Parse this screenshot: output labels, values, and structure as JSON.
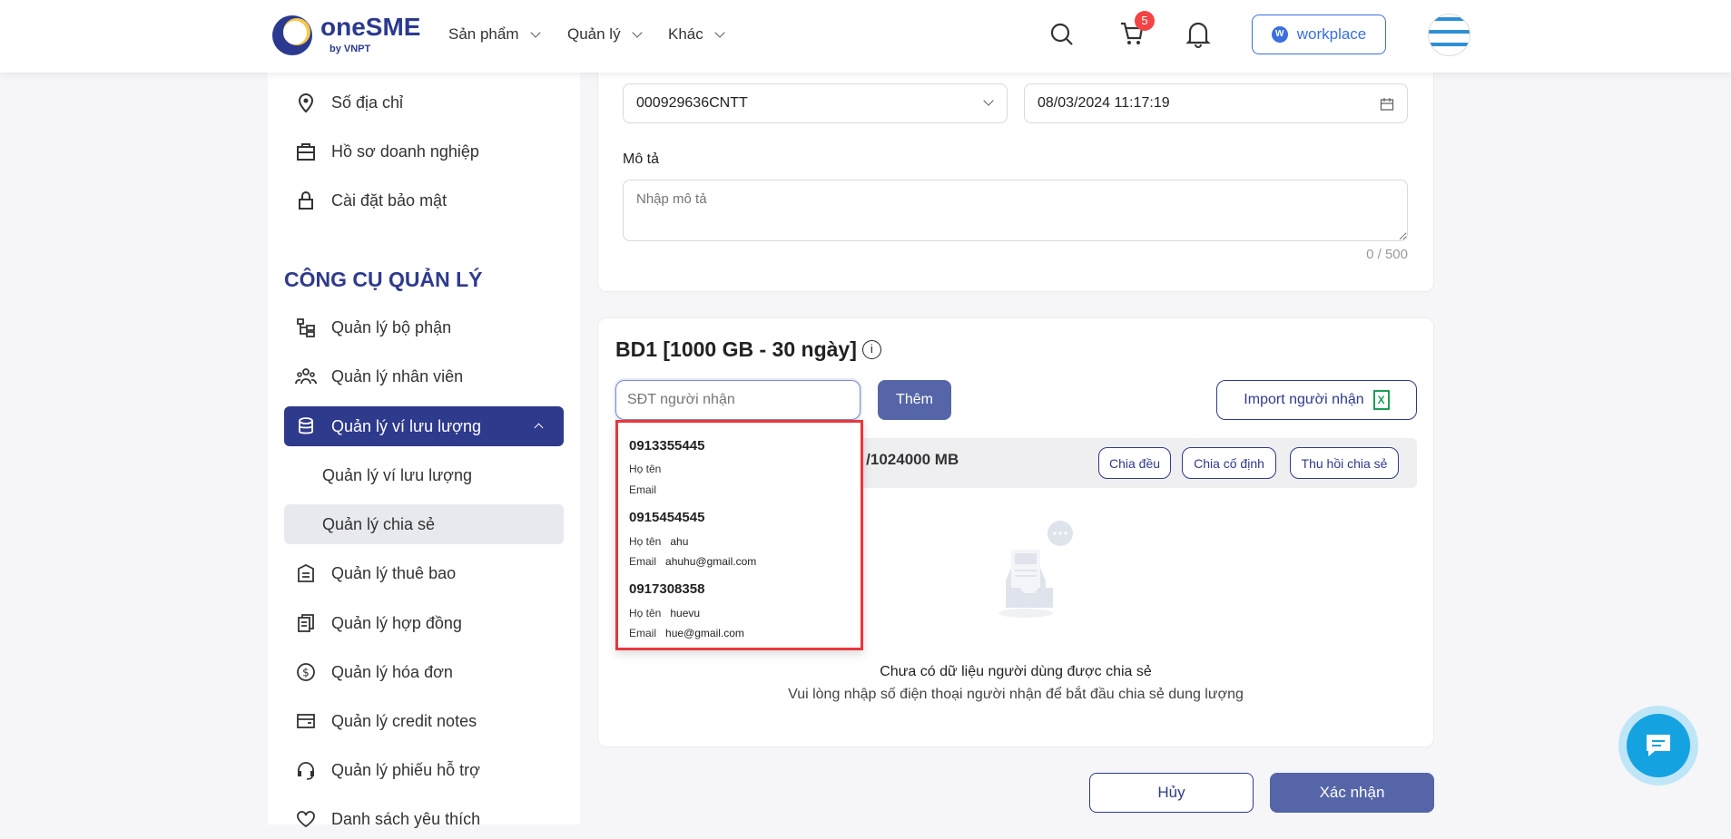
{
  "header": {
    "logo_text": "oneSME",
    "logo_sub": "by VNPT",
    "nav": [
      "Sản phẩm",
      "Quản lý",
      "Khác"
    ],
    "cart_count": "5",
    "workplace_label": "workplace"
  },
  "sidebar": {
    "top_items": [
      "Số địa chỉ",
      "Hồ sơ doanh nghiệp",
      "Cài đặt bảo mật"
    ],
    "section_title": "CÔNG CỤ QUẢN LÝ",
    "items": [
      "Quản lý bộ phận",
      "Quản lý nhân viên",
      "Quản lý ví lưu lượng",
      "Quản lý ví lưu lượng",
      "Quản lý chia sẻ",
      "Quản lý thuê bao",
      "Quản lý hợp đồng",
      "Quản lý hóa đơn",
      "Quản lý credit notes",
      "Quản lý phiếu hỗ trợ",
      "Danh sách yêu thích"
    ]
  },
  "form": {
    "account_value": "000929636CNTT",
    "date_value": "08/03/2024 11:17:19",
    "desc_label": "Mô tả",
    "desc_placeholder": "Nhập mô tả",
    "desc_counter": "0 / 500"
  },
  "share": {
    "title": "BD1 [1000 GB - 30 ngày]",
    "phone_placeholder": "SĐT người nhận",
    "add_label": "Thêm",
    "import_label": "Import người nhận",
    "total_text": "0 /1024000 MB",
    "actions": [
      "Chia đều",
      "Chia cố định",
      "Thu hồi chia sẻ"
    ],
    "empty_title": "Chưa có dữ liệu người dùng được chia sẻ",
    "empty_desc": "Vui lòng nhập số điện thoại người nhận để bắt đầu chia sẻ dung lượng"
  },
  "suggestions": {
    "name_label": "Họ tên",
    "email_label": "Email",
    "items": [
      {
        "phone": "0913355445",
        "name": "",
        "email": ""
      },
      {
        "phone": "0915454545",
        "name": "ahu",
        "email": "ahuhu@gmail.com"
      },
      {
        "phone": "0917308358",
        "name": "huevu",
        "email": "hue@gmail.com"
      }
    ]
  },
  "footer": {
    "cancel_label": "Hủy",
    "confirm_label": "Xác nhận"
  },
  "colors": {
    "primary": "#2e3a8c",
    "button": "#5565a8",
    "highlight": "#e8373d",
    "badge": "#f24444"
  }
}
